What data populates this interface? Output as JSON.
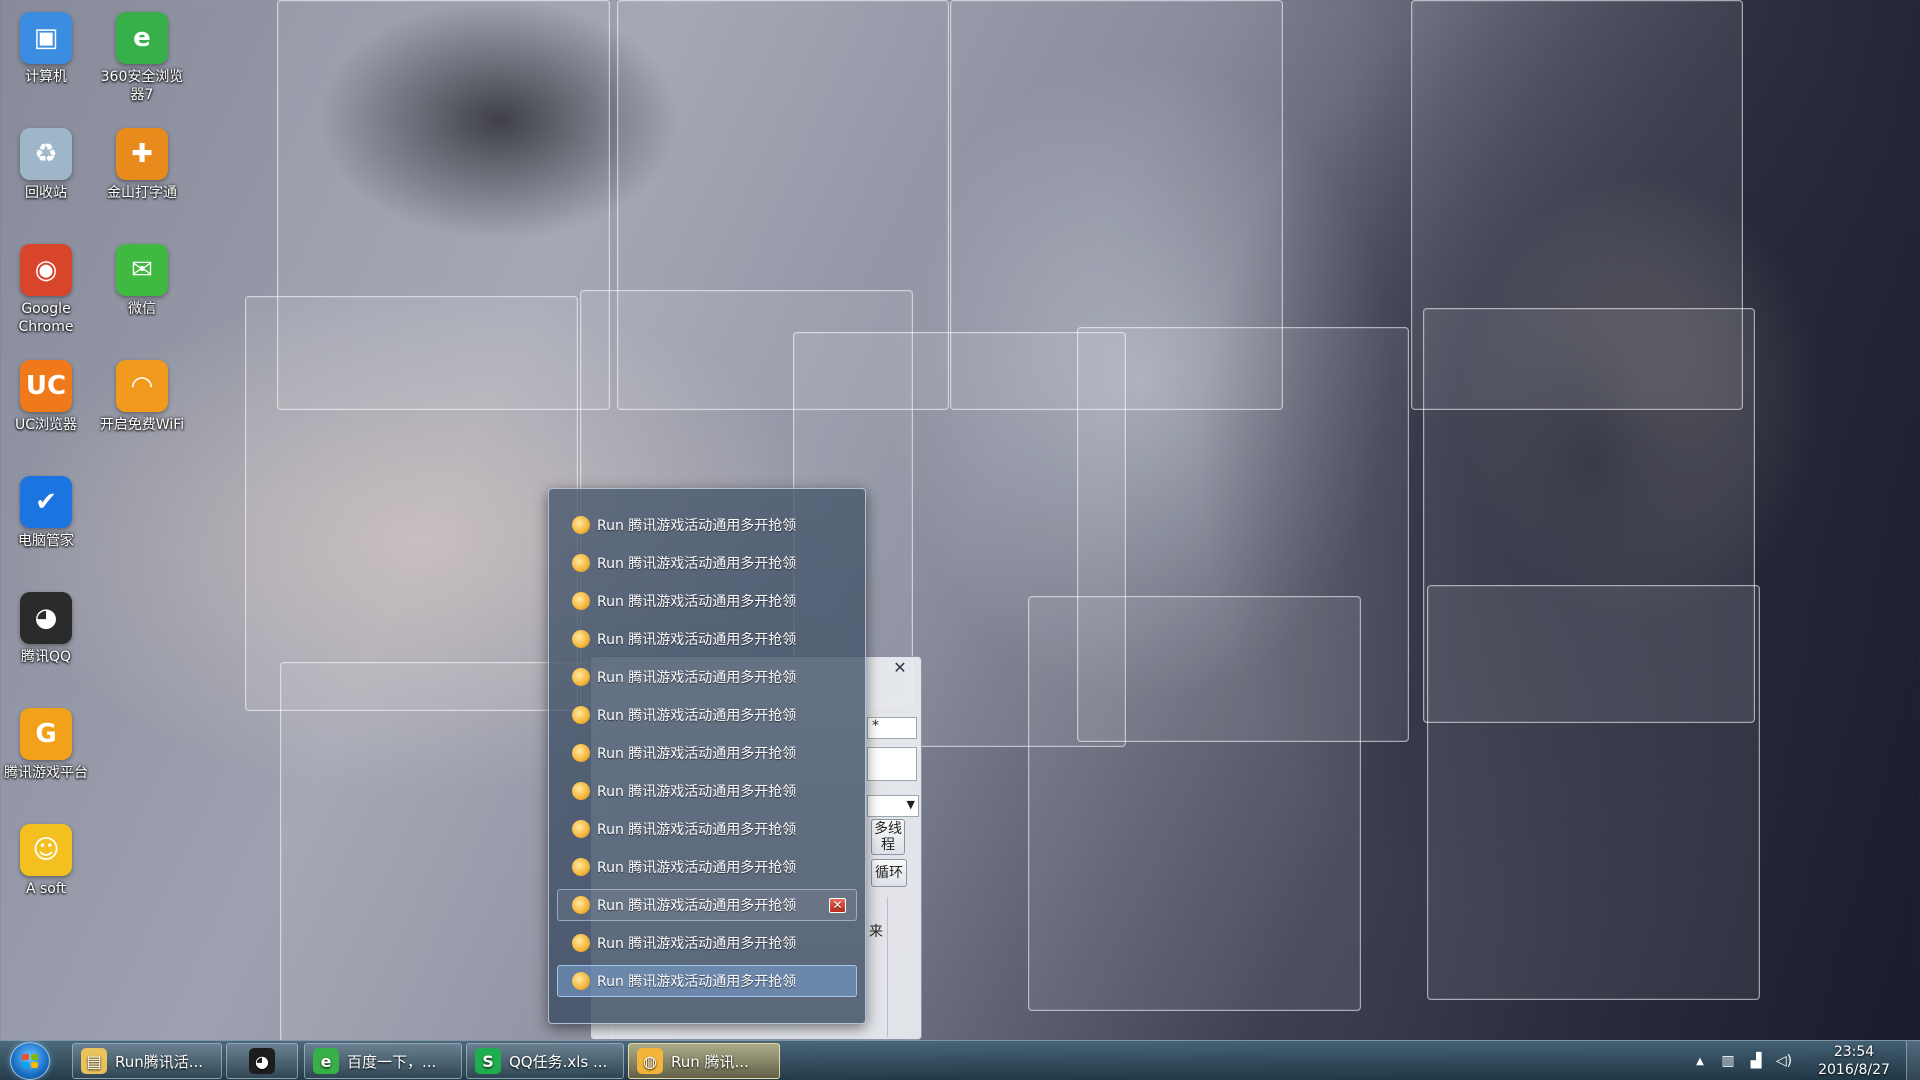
{
  "desktop": {
    "icons": [
      {
        "label": "计算机",
        "icon": "computer-icon",
        "color": "#3a8de0",
        "glyph": "▣"
      },
      {
        "label": "360安全浏览器7",
        "icon": "browser-360-icon",
        "color": "#38b04a",
        "glyph": "e"
      },
      {
        "label": "回收站",
        "icon": "recycle-bin-icon",
        "color": "#9fb6c8",
        "glyph": "♻"
      },
      {
        "label": "金山打字通",
        "icon": "typing-app-icon",
        "color": "#e98a1d",
        "glyph": "✚"
      },
      {
        "label": "Google Chrome",
        "icon": "chrome-icon",
        "color": "#d9452b",
        "glyph": "◉"
      },
      {
        "label": "微信",
        "icon": "wechat-icon",
        "color": "#40b940",
        "glyph": "✉"
      },
      {
        "label": "UC浏览器",
        "icon": "uc-browser-icon",
        "color": "#f07a1a",
        "glyph": "UC"
      },
      {
        "label": "开启免费WiFi",
        "icon": "wifi-icon",
        "color": "#f29a1e",
        "glyph": "◠"
      },
      {
        "label": "电脑管家",
        "icon": "pc-manager-icon",
        "color": "#1b74e0",
        "glyph": "✔"
      },
      {
        "label": "腾讯QQ",
        "icon": "qq-penguin-icon",
        "color": "#2b2b2b",
        "glyph": "◕"
      },
      {
        "label": "腾讯游戏平台",
        "icon": "tencent-games-icon",
        "color": "#f2a21a",
        "glyph": "G"
      },
      {
        "label": "A soft",
        "icon": "smiley-icon",
        "color": "#f4c020",
        "glyph": "☺"
      }
    ]
  },
  "popup": {
    "items": [
      {
        "label": "Run 腾讯游戏活动通用多开抢领"
      },
      {
        "label": "Run 腾讯游戏活动通用多开抢领"
      },
      {
        "label": "Run 腾讯游戏活动通用多开抢领"
      },
      {
        "label": "Run 腾讯游戏活动通用多开抢领"
      },
      {
        "label": "Run 腾讯游戏活动通用多开抢领"
      },
      {
        "label": "Run 腾讯游戏活动通用多开抢领"
      },
      {
        "label": "Run 腾讯游戏活动通用多开抢领"
      },
      {
        "label": "Run 腾讯游戏活动通用多开抢领"
      },
      {
        "label": "Run 腾讯游戏活动通用多开抢领"
      },
      {
        "label": "Run 腾讯游戏活动通用多开抢领"
      },
      {
        "label": "Run 腾讯游戏活动通用多开抢领",
        "state": "hover"
      },
      {
        "label": "Run 腾讯游戏活动通用多开抢领"
      },
      {
        "label": "Run 腾讯游戏活动通用多开抢领",
        "state": "selected"
      }
    ],
    "close_glyph": "✕"
  },
  "back_window": {
    "close_glyph": "✕",
    "field_value": "*",
    "multi_thread_label": "多线程",
    "loop_label": "循环",
    "partial_text": "来"
  },
  "taskbar": {
    "start_colors": [
      "#f25022",
      "#7fba00",
      "#00a4ef",
      "#ffb900"
    ],
    "buttons": [
      {
        "label": "Run腾讯活...",
        "icon": "folder-icon",
        "color": "#e8c25a",
        "glyph": "▤"
      },
      {
        "label": "",
        "icon": "qq-penguin-icon",
        "color": "#1d1d1d",
        "glyph": "◕"
      },
      {
        "label": "百度一下，...",
        "icon": "browser-360-icon",
        "color": "#38b04a",
        "glyph": "e"
      },
      {
        "label": "QQ任务.xls ...",
        "icon": "spreadsheet-icon",
        "color": "#1fae4f",
        "glyph": "S"
      },
      {
        "label": "Run 腾讯...",
        "icon": "app-orange-icon",
        "color": "#f2b53a",
        "glyph": "◍"
      }
    ],
    "tray": {
      "expand_glyph": "▲",
      "icons": [
        {
          "name": "device-icon",
          "glyph": "▥"
        },
        {
          "name": "network-icon",
          "glyph": "▟"
        },
        {
          "name": "volume-icon",
          "glyph": "◁)"
        }
      ],
      "time": "23:54",
      "date": "2016/8/27"
    }
  }
}
